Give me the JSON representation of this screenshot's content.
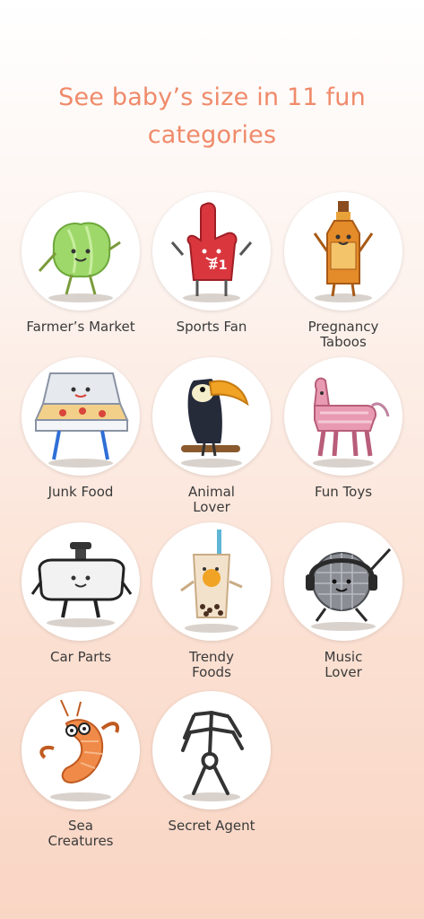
{
  "headline": "See baby’s size in 11  fun\ncategories",
  "categories": [
    {
      "label": "Farmer’s Market",
      "icon": "lettuce-icon"
    },
    {
      "label": "Sports Fan",
      "icon": "foam-finger-icon"
    },
    {
      "label": "Pregnancy\nTaboos",
      "icon": "whiskey-bottle-icon"
    },
    {
      "label": "Junk Food",
      "icon": "pizza-box-icon"
    },
    {
      "label": "Animal\nLover",
      "icon": "toucan-icon"
    },
    {
      "label": "Fun Toys",
      "icon": "pinata-icon"
    },
    {
      "label": "Car Parts",
      "icon": "rearview-mirror-icon"
    },
    {
      "label": "Trendy\nFoods",
      "icon": "bubble-tea-icon"
    },
    {
      "label": "Music\nLover",
      "icon": "disco-ball-icon"
    },
    {
      "label": "Sea\nCreatures",
      "icon": "shrimp-icon"
    },
    {
      "label": "Secret Agent",
      "icon": "stick-figure-icon"
    }
  ]
}
